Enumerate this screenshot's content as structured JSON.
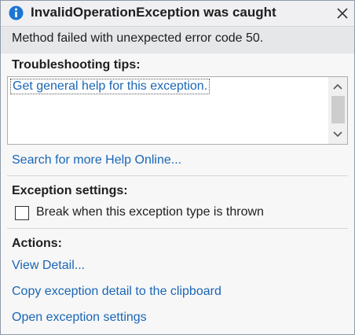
{
  "title": "InvalidOperationException was caught",
  "message": "Method failed with unexpected error code 50.",
  "troubleshooting": {
    "heading": "Troubleshooting tips:",
    "tips": [
      "Get general help for this exception."
    ],
    "search_link": "Search for more Help Online..."
  },
  "exception_settings": {
    "heading": "Exception settings:",
    "checkbox_label": "Break when this exception type is thrown",
    "checked": false
  },
  "actions": {
    "heading": "Actions:",
    "links": [
      "View Detail...",
      "Copy exception detail to the clipboard",
      "Open exception settings"
    ]
  },
  "colors": {
    "link": "#1a66b5",
    "info_icon": "#1c76d2"
  },
  "icons": {
    "title": "info-icon",
    "close": "close-icon",
    "scroll_up": "chevron-up-icon",
    "scroll_down": "chevron-down-icon"
  }
}
